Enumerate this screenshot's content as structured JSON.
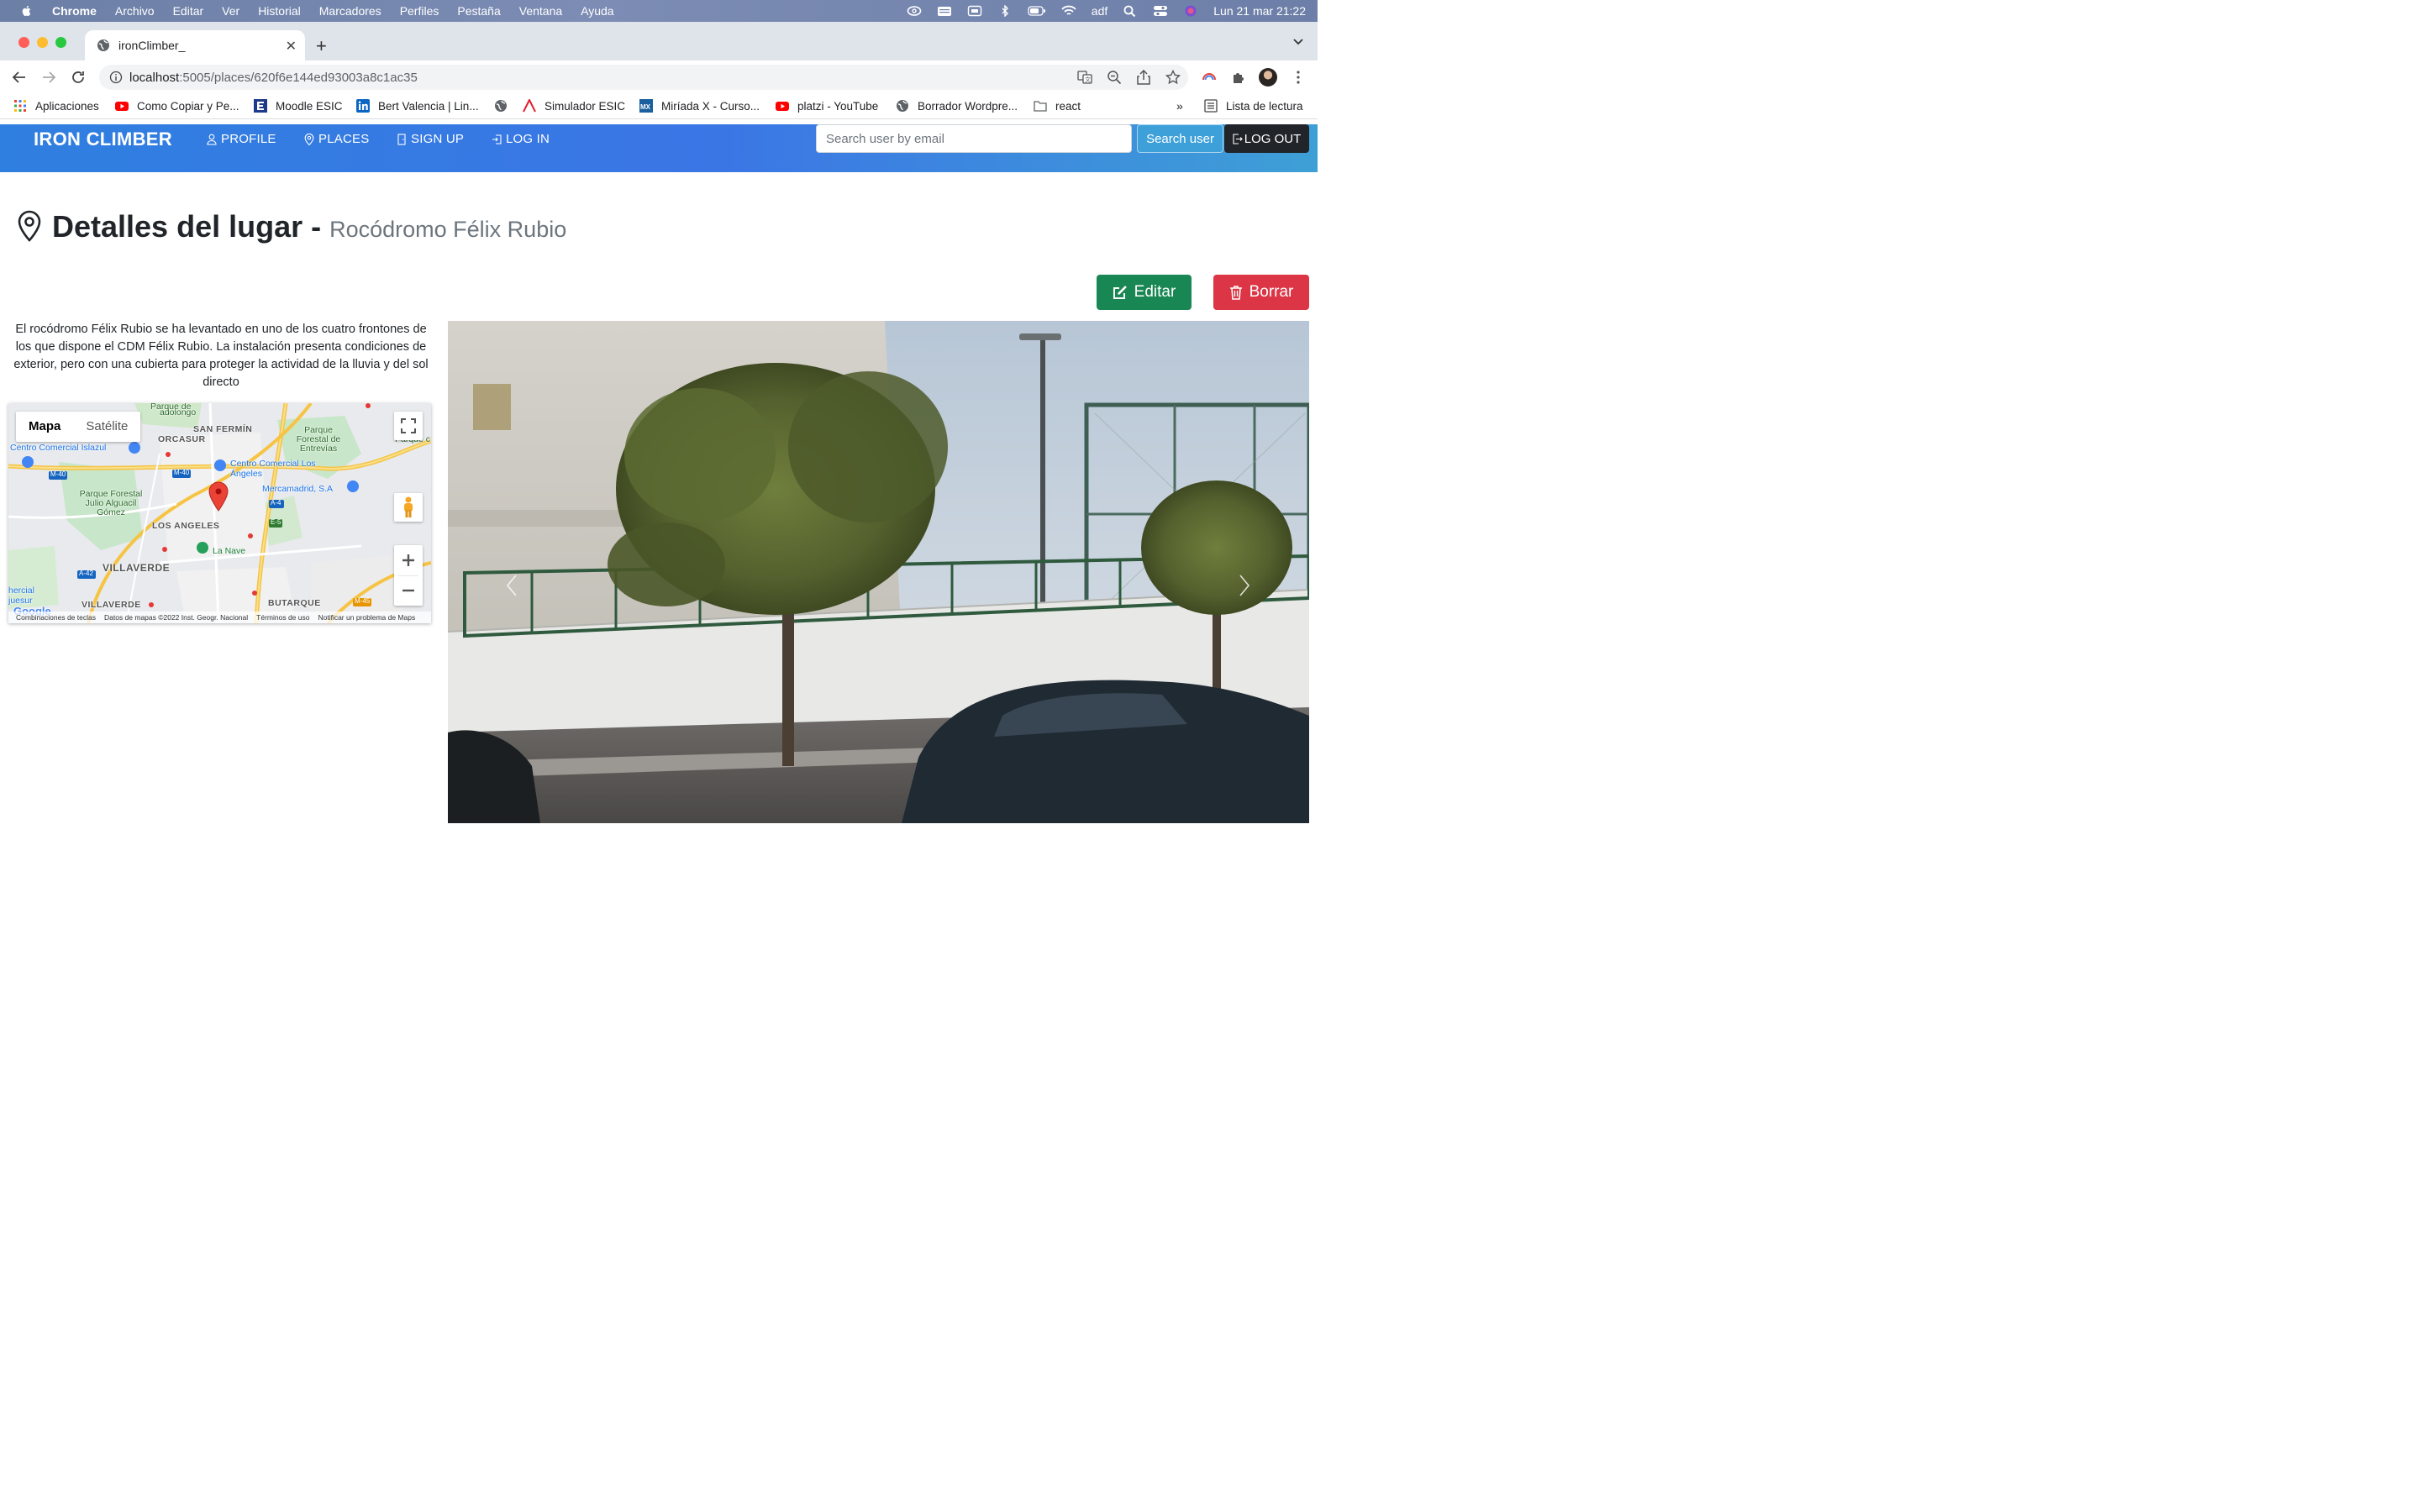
{
  "os_menu": {
    "app": "Chrome",
    "items": [
      "Archivo",
      "Editar",
      "Ver",
      "Historial",
      "Marcadores",
      "Perfiles",
      "Pestaña",
      "Ventana",
      "Ayuda"
    ],
    "user": "adf",
    "datetime": "Lun 21 mar  21:22"
  },
  "browser": {
    "tab_title": "ironClimber_",
    "url_host": "localhost",
    "url_path": ":5005/places/620f6e144ed93003a8c1ac35",
    "bookmarks": [
      {
        "label": "Aplicaciones",
        "icon": "apps-grid-icon"
      },
      {
        "label": "Como Copiar y Pe...",
        "icon": "youtube-icon"
      },
      {
        "label": "Moodle ESIC",
        "icon": "moodle-icon"
      },
      {
        "label": "Bert Valencia | Lin...",
        "icon": "linkedin-icon"
      },
      {
        "label": "",
        "icon": "globe-icon"
      },
      {
        "label": "Simulador ESIC",
        "icon": "esic-icon"
      },
      {
        "label": "Miríada X - Curso...",
        "icon": "miriadax-icon"
      },
      {
        "label": "platzi - YouTube",
        "icon": "youtube-icon"
      },
      {
        "label": "Borrador Wordpre...",
        "icon": "globe-icon"
      },
      {
        "label": "react",
        "icon": "folder-icon"
      }
    ],
    "more_bookmarks": "»",
    "reading_list": "Lista de lectura"
  },
  "navbar": {
    "brand": "IRON CLIMBER",
    "links": [
      "PROFILE",
      "PLACES",
      "SIGN UP",
      "LOG IN"
    ],
    "search_placeholder": "Search user by email",
    "search_button": "Search user",
    "logout_button": "LOG OUT"
  },
  "page": {
    "title": "Detalles del lugar -",
    "place_name": "Rocódromo Félix Rubio",
    "edit_button": "Editar",
    "delete_button": "Borrar",
    "description": "El rocódromo Félix Rubio se ha levantado en uno de los cuatro frontones de los que dispone el CDM Félix Rubio. La instalación presenta condiciones de exterior, pero con una cubierta para proteger la actividad de la lluvia y del sol directo"
  },
  "map": {
    "type_map": "Mapa",
    "type_satellite": "Satélite",
    "labels": {
      "san_fermin": "SAN FERMÍN",
      "orcasur": "ORCASUR",
      "los_angeles": "LOS ANGELES",
      "villaverde": "VILLAVERDE",
      "villaverde2": "VILLAVERDE",
      "butarque": "BUTARQUE",
      "adolongo": "adolongo",
      "parque_entrevias": "Parque Forestal de Entrevías",
      "parque_julio": "Parque Forestal Julio Alguacil Gómez",
      "cc_islazul": "Centro Comercial Islazul",
      "cc_los_angeles": "Centro Comercial Los Ángeles",
      "mercamadrid": "Mercamadrid, S.A",
      "la_nave": "La Nave",
      "parque_de": "Parque de",
      "hercial": "hercial",
      "juesur": "juesur",
      "parque_fc": "Parque c",
      "m40a": "M-40",
      "m40b": "M-40",
      "a4": "A-4",
      "e5": "E-5",
      "a42": "A-42",
      "m45": "M-45"
    },
    "footer": [
      "Combinaciones de teclas",
      "Datos de mapas ©2022 Inst. Geogr. Nacional",
      "Términos de uso",
      "Notificar un problema de Maps"
    ],
    "google_logo": "Google"
  },
  "colors": {
    "navbar_start": "#2f7fe0",
    "navbar_end": "#3e9fd6",
    "edit": "#198754",
    "delete": "#dc3545",
    "logout": "#212529"
  }
}
